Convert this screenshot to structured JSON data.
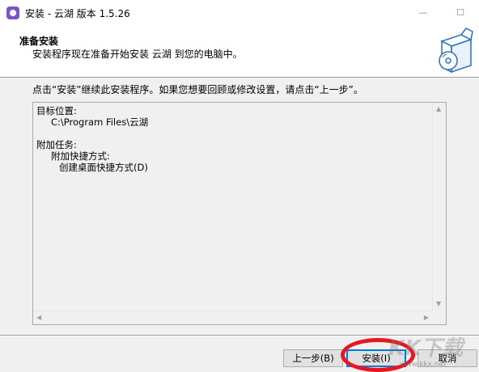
{
  "window": {
    "title": "安装 - 云湖 版本 1.5.26",
    "minimize_glyph": "—",
    "maximize_glyph": "☐",
    "close_glyph": "✕"
  },
  "header": {
    "heading": "准备安装",
    "subheading": "安装程序现在准备开始安装 云湖 到您的电脑中。",
    "icon": "setup-box-disc-icon"
  },
  "intro_text": "点击“安装”继续此安装程序。如果您想要回顾或修改设置，请点击“上一步”。",
  "memo": {
    "dest_label": "目标位置:",
    "dest_path": "C:\\Program Files\\云湖",
    "tasks_label": "附加任务:",
    "tasks_group": "附加快捷方式:",
    "task_item": "创建桌面快捷方式(D)"
  },
  "buttons": {
    "back": "上一步(B)",
    "install": "安装(I)",
    "cancel": "取消"
  },
  "annotation": {
    "ring_color": "#e8161e",
    "target": "install-button"
  },
  "watermark": {
    "logo": "KK下载",
    "url": "www.kkx.net"
  },
  "colors": {
    "accent": "#0078d7",
    "app_icon": "#7b55c7"
  }
}
